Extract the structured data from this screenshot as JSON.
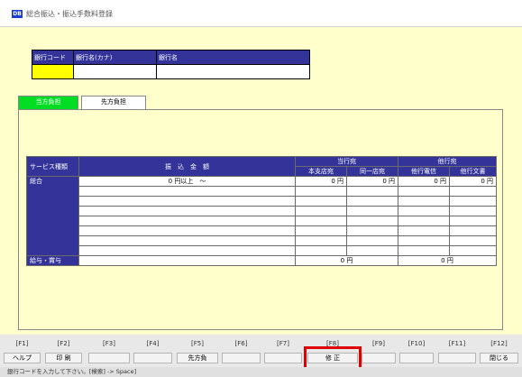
{
  "window": {
    "title": "総合振込・振込手数料登録",
    "icon_label": "DB"
  },
  "bank_header": {
    "columns": [
      "銀行コード",
      "銀行名(カナ)",
      "銀行名"
    ],
    "values": [
      "",
      "",
      ""
    ]
  },
  "tabs": [
    {
      "label": "当方負担",
      "active": true
    },
    {
      "label": "先方負担",
      "active": false
    }
  ],
  "fee_table": {
    "service_header": "サービス種類",
    "amount_header": "振　込　金　額",
    "own_bank_header": "当行宛",
    "other_bank_header": "他行宛",
    "sub_headers": [
      "本支店宛",
      "同一店宛",
      "他行電信",
      "他行文書"
    ],
    "rows": [
      {
        "label": "総合",
        "amount": "0 円以上　～",
        "values": [
          "0 円",
          "0 円",
          "0 円",
          "0 円"
        ]
      }
    ],
    "salary_row": {
      "label": "給与・賞与",
      "own_value": "0 円",
      "other_value": "0 円"
    }
  },
  "function_keys": [
    {
      "key": "[F1]",
      "label": "ヘルプ"
    },
    {
      "key": "[F2]",
      "label": "印 刷"
    },
    {
      "key": "[F3]",
      "label": ""
    },
    {
      "key": "[F4]",
      "label": ""
    },
    {
      "key": "[F5]",
      "label": "先方負"
    },
    {
      "key": "[F6]",
      "label": ""
    },
    {
      "key": "[F7]",
      "label": ""
    },
    {
      "key": "[F8]",
      "label": "修 正"
    },
    {
      "key": "[F9]",
      "label": ""
    },
    {
      "key": "[F10]",
      "label": ""
    },
    {
      "key": "[F11]",
      "label": ""
    },
    {
      "key": "[F12]",
      "label": "閉じる"
    }
  ],
  "status_bar": "銀行コードを入力して下さい。[検索] -> Space]"
}
